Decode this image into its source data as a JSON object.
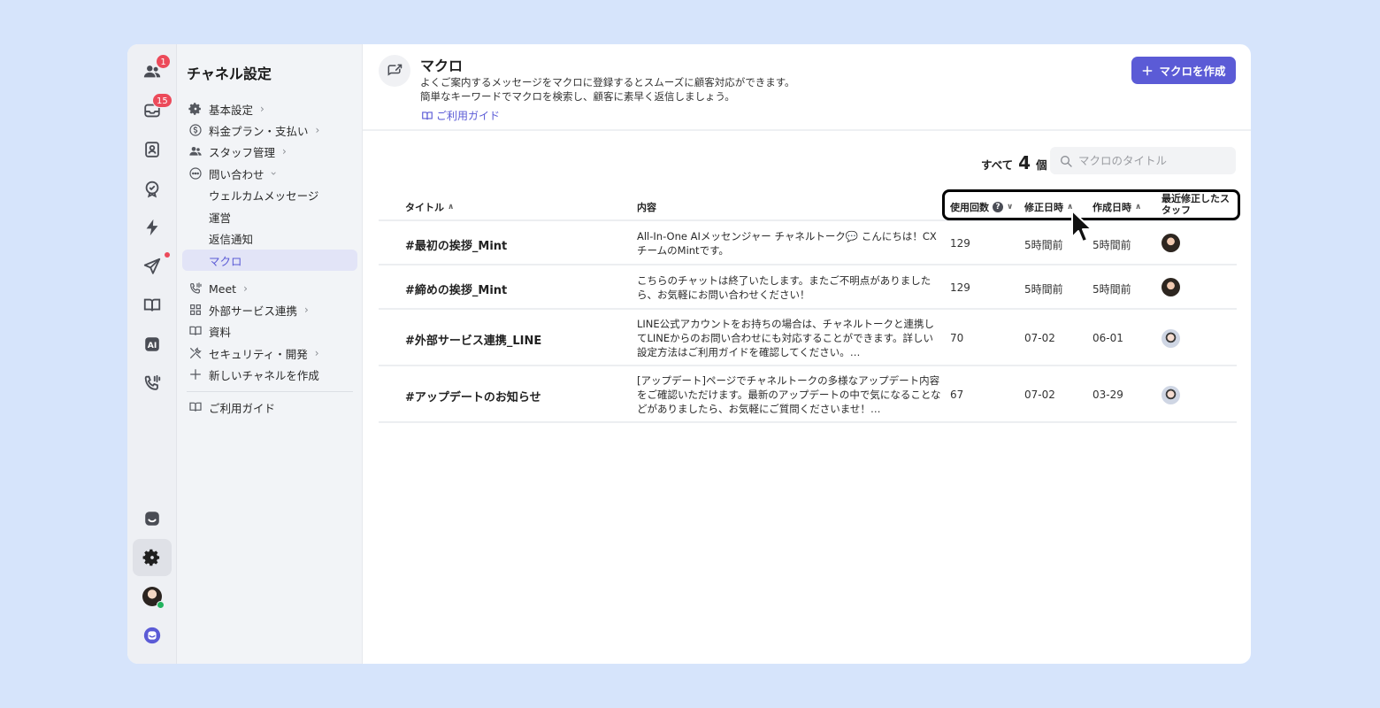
{
  "rail": {
    "items": [
      {
        "icon": "team-icon",
        "badge": "1"
      },
      {
        "icon": "inbox-icon",
        "badge": "15"
      },
      {
        "icon": "contact-icon"
      },
      {
        "icon": "verified-icon"
      },
      {
        "icon": "lightning-icon"
      },
      {
        "icon": "send-icon"
      },
      {
        "icon": "book-icon"
      },
      {
        "icon": "ai-icon",
        "label": "AI"
      },
      {
        "icon": "meet-phone-icon"
      }
    ],
    "bottom": [
      {
        "icon": "chat-icon"
      },
      {
        "icon": "gear-icon"
      },
      {
        "icon": "avatar"
      },
      {
        "icon": "channel-logo-icon"
      }
    ]
  },
  "sidebar": {
    "title": "チャネル設定",
    "items": [
      {
        "label": "基本設定",
        "icon": "gear-icon"
      },
      {
        "label": "料金プラン・支払い",
        "icon": "dollar-icon"
      },
      {
        "label": "スタッフ管理",
        "icon": "team-icon"
      },
      {
        "label": "問い合わせ",
        "icon": "chat-dots-icon"
      },
      {
        "label": "ウェルカムメッセージ"
      },
      {
        "label": "運営"
      },
      {
        "label": "返信通知"
      },
      {
        "label": "マクロ"
      },
      {
        "label": "Meet",
        "icon": "meet-phone-icon"
      },
      {
        "label": "外部サービス連携",
        "icon": "grid-icon"
      },
      {
        "label": "資料",
        "icon": "book-icon"
      },
      {
        "label": "セキュリティ・開発",
        "icon": "tools-icon"
      },
      {
        "label": "新しいチャネルを作成",
        "icon": "plus-icon"
      },
      {
        "label": "ご利用ガイド",
        "icon": "book-icon"
      }
    ]
  },
  "header": {
    "title": "マクロ",
    "desc_line1": "よくご案内するメッセージをマクロに登録するとスムーズに顧客対応ができます。",
    "desc_line2": "簡単なキーワードでマクロを検索し、顧客に素早く返信しましょう。",
    "guide_link": "ご利用ガイド",
    "create_button": "マクロを作成"
  },
  "toolbar": {
    "count_prefix": "すべて",
    "count": "4",
    "count_suffix": "個",
    "search_placeholder": "マクロのタイトル"
  },
  "table": {
    "headers": {
      "title": "タイトル",
      "content": "内容",
      "usage": "使用回数",
      "modified": "修正日時",
      "created": "作成日時",
      "staff": "最近修正したスタッフ"
    },
    "rows": [
      {
        "title": "#最初の挨拶_Mint",
        "content": "All-In-One AIメッセンジャー チャネルトーク💬 こんにちは！CXチームのMintです。",
        "usage": "129",
        "modified": "5時間前",
        "created": "5時間前",
        "staff": "dark"
      },
      {
        "title": "#締めの挨拶_Mint",
        "content": "こちらのチャットは終了いたします。またご不明点がありましたら、お気軽にお問い合わせください！",
        "usage": "129",
        "modified": "5時間前",
        "created": "5時間前",
        "staff": "dark"
      },
      {
        "title": "#外部サービス連携_LINE",
        "content": "LINE公式アカウントをお持ちの場合は、チャネルトークと連携してLINEからのお問い合わせにも対応することができます。詳しい設定方法はご利用ガイドを確認してください。https://docs.channel.i...",
        "usage": "70",
        "modified": "07-02",
        "created": "06-01",
        "staff": "light"
      },
      {
        "title": "#アップデートのお知らせ",
        "content": "[アップデート]ページでチャネルトークの多様なアップデート内容をご確認いただけます。最新のアップデートの中で気になることなどがありましたら、お気軽にご質問くださいませ！https://docs....",
        "usage": "67",
        "modified": "07-02",
        "created": "03-29",
        "staff": "light"
      }
    ]
  },
  "colors": {
    "accent": "#5b5bd6",
    "background": "#d6e4fb",
    "badge": "#ec4a5a"
  }
}
